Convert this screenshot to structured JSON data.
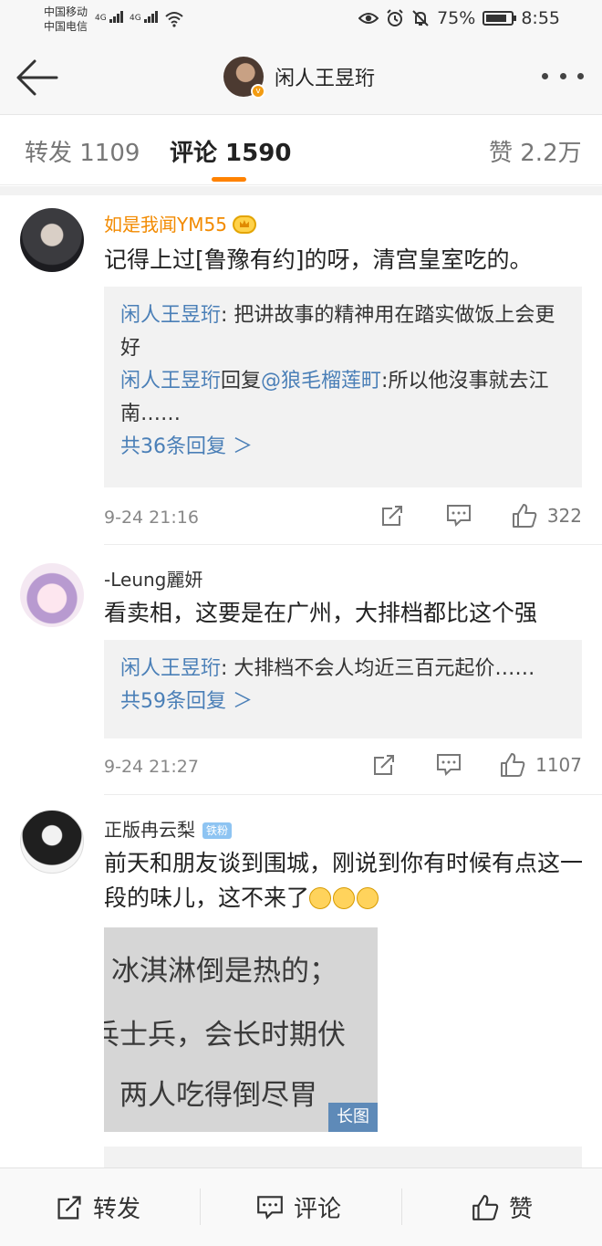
{
  "status_bar": {
    "carrier1": "中国移动",
    "carrier2": "中国电信",
    "network1": "4G",
    "network2": "4G",
    "battery": "75%",
    "time": "8:55"
  },
  "nav": {
    "title": "闲人王昱珩"
  },
  "tabs": {
    "repost": "转发 1109",
    "comments": "评论 1590",
    "likes": "赞 2.2万"
  },
  "comments": [
    {
      "user": "如是我闻YM55",
      "text": "记得上过[鲁豫有约]的呀，清宫皇室吃的。",
      "replies": [
        {
          "name": "闲人王昱珩",
          "text": ": 把讲故事的精神用在踏实做饭上会更好"
        },
        {
          "name": "闲人王昱珩",
          "mid": "回复",
          "mention": "@狼毛榴莲町",
          "text": ":所以他沒事就去江南……"
        }
      ],
      "more_replies": "共36条回复 ＞",
      "time": "9-24 21:16",
      "likes": "322"
    },
    {
      "user": "-Leung麗妍",
      "text": "看卖相，这要是在广州，大排档都比这个强",
      "replies": [
        {
          "name": "闲人王昱珩",
          "text": ": 大排档不会人均近三百元起价……"
        }
      ],
      "more_replies": "共59条回复 ＞",
      "time": "9-24 21:27",
      "likes": "1107"
    },
    {
      "user": "正版冉云梨",
      "badge": "铁粉",
      "text": "前天和朋友谈到围城，刚说到你有时候有点这一段的味儿，这不来了",
      "image_lines": [
        "冰淇淋倒是热的；",
        "兵士兵，会长时期伏",
        "。两人吃得倒尽胃"
      ],
      "image_badge": "长图"
    }
  ],
  "bottom_bar": {
    "repost": "转发",
    "comment": "评论",
    "like": "赞"
  },
  "colors": {
    "accent": "#ff8200",
    "link": "#4a7fb7",
    "vip_name": "#f28a00"
  }
}
